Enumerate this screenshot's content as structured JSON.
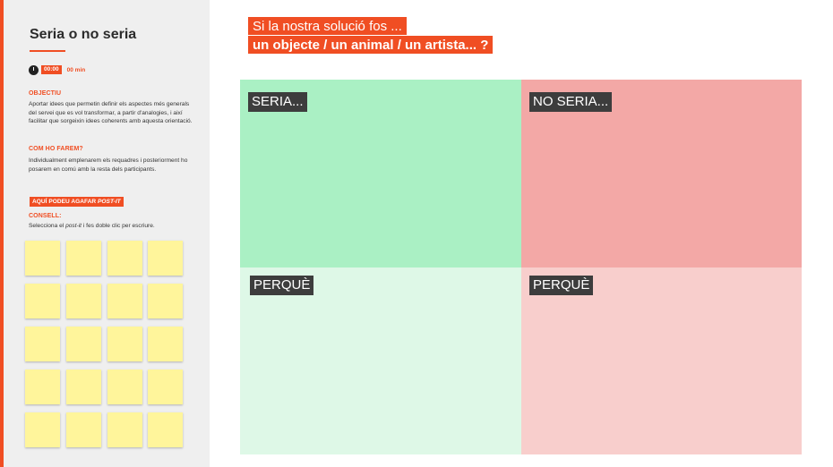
{
  "sidebar": {
    "title": "Seria o no seria",
    "timer": {
      "time": "00:00",
      "minutes": "00 min"
    },
    "sections": [
      {
        "heading": "OBJECTIU",
        "text": "Aportar idees que permetin definir els aspectes més generals del servei que es vol transformar, a partir d'analogies, i així facilitar que sorgeixin idees coherents amb aquesta orientació."
      },
      {
        "heading": "COM HO FAREM?",
        "text": "Individualment emplenarem els requadres i posteriorment ho posarem en comú amb la resta dels participants."
      }
    ],
    "postit_tag": {
      "prefix": "AQUÍ PODEU AGAFAR ",
      "emphasis": "POST-IT"
    },
    "tip": {
      "heading": "CONSELL:",
      "prefix": "Selecciona el ",
      "emphasis": "post-it",
      "suffix": " i fes doble clic per escriure."
    },
    "postit_color": "#fff59b"
  },
  "header": {
    "line1": "Si la nostra solució fos ...",
    "line2": "un objecte / un animal / un artista... ?"
  },
  "board": {
    "seria_label": "SERIA...",
    "no_seria_label": "NO SERIA...",
    "perque_left_label": "PERQUÈ",
    "perque_right_label": "PERQUÈ"
  },
  "colors": {
    "accent": "#f04e23",
    "seria": "#aaf0c4",
    "no_seria": "#f3a8a6",
    "perque_left": "#def8e7",
    "perque_right": "#f8cecc",
    "label_bg": "#3d3d3d"
  }
}
